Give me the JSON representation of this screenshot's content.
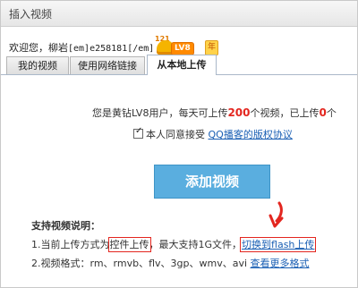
{
  "dialog": {
    "title": "插入视频"
  },
  "welcome": {
    "prefix": "欢迎您，柳岩",
    "user_tag": "[em]e258181[/em]"
  },
  "badges": {
    "number": "121",
    "level": "LV8",
    "year": "年"
  },
  "tabs": [
    {
      "label": "我的视频"
    },
    {
      "label": "使用网络链接"
    },
    {
      "label": "从本地上传"
    }
  ],
  "upload": {
    "info_before": "您是黄钻LV8用户，每天可上传",
    "limit": "200",
    "info_middle": "个视频，已上传",
    "uploaded": "0",
    "info_after": "个",
    "consent_text": "本人同意接受",
    "consent_link": "QQ播客的版权协议",
    "add_button": "添加视频"
  },
  "help": {
    "title": "支持视频说明：",
    "line1_before": "1.当前上传方式为",
    "line1_boxed": "控件上传",
    "line1_middle": "，最大支持1G文件，",
    "line1_link": "切换到flash上传",
    "line2_before": "2.视频格式：rm、rmvb、flv、3gp、wmv、avi ",
    "line2_link": "查看更多格式"
  },
  "colors": {
    "highlight": "#e3261f",
    "link": "#1a5fb4",
    "button": "#5aaedf"
  }
}
